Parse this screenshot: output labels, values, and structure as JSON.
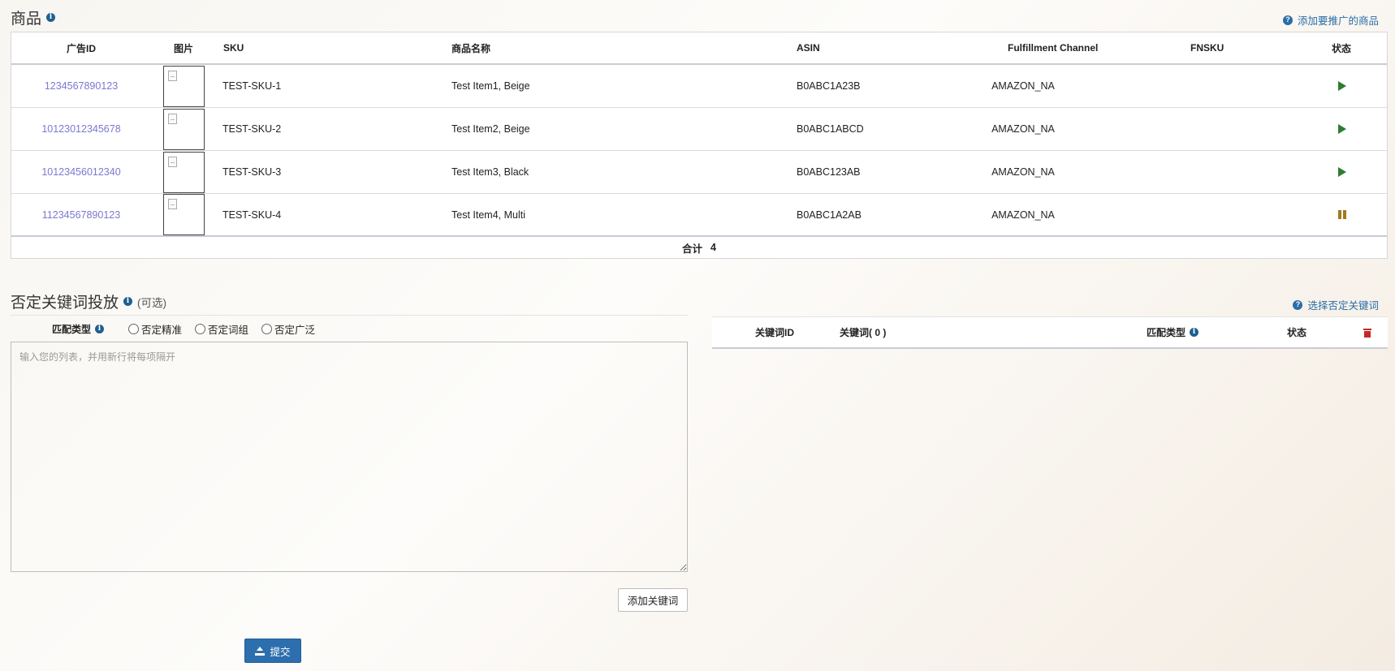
{
  "products": {
    "title": "商品",
    "add_link": "添加要推广的商品",
    "columns": {
      "ad_id": "广告ID",
      "image": "图片",
      "sku": "SKU",
      "name": "商品名称",
      "asin": "ASIN",
      "fulfillment": "Fulfillment Channel",
      "fnsku": "FNSKU",
      "status": "状态"
    },
    "rows": [
      {
        "ad_id": "1234567890123",
        "sku": "TEST-SKU-1",
        "name": "Test Item1, Beige",
        "asin": "B0ABC1A23B",
        "fulfillment": "AMAZON_NA",
        "fnsku": "",
        "status": "active"
      },
      {
        "ad_id": "10123012345678",
        "sku": "TEST-SKU-2",
        "name": "Test Item2, Beige",
        "asin": "B0ABC1ABCD",
        "fulfillment": "AMAZON_NA",
        "fnsku": "",
        "status": "active"
      },
      {
        "ad_id": "10123456012340",
        "sku": "TEST-SKU-3",
        "name": "Test Item3, Black",
        "asin": "B0ABC123AB",
        "fulfillment": "AMAZON_NA",
        "fnsku": "",
        "status": "active"
      },
      {
        "ad_id": "11234567890123",
        "sku": "TEST-SKU-4",
        "name": "Test Item4, Multi",
        "asin": "B0ABC1A2AB",
        "fulfillment": "AMAZON_NA",
        "fnsku": "",
        "status": "paused"
      }
    ],
    "total_label": "合计",
    "total_value": "4"
  },
  "negative_keywords": {
    "title": "否定关键词投放",
    "optional": "(可选)",
    "select_link": "选择否定关键词",
    "match_type_label": "匹配类型",
    "options": [
      "否定精准",
      "否定词组",
      "否定广泛"
    ],
    "textarea_placeholder": "输入您的列表，并用新行将每项隔开",
    "add_button": "添加关键词",
    "table": {
      "keyword_id": "关键词ID",
      "keyword": "关键词( 0 )",
      "match_type": "匹配类型",
      "status": "状态"
    }
  },
  "submit_button": "提交",
  "icons": {
    "info": "info-icon",
    "help": "question-circle-icon",
    "play": "play-icon",
    "pause": "pause-icon",
    "trash": "trash-icon",
    "upload": "upload-icon"
  },
  "colors": {
    "link": "#2a6ea8",
    "ad_id_link": "#7b78d0",
    "active": "#2e7d32",
    "paused": "#a07a1c",
    "delete": "#c62828",
    "primary": "#2d6fae"
  }
}
